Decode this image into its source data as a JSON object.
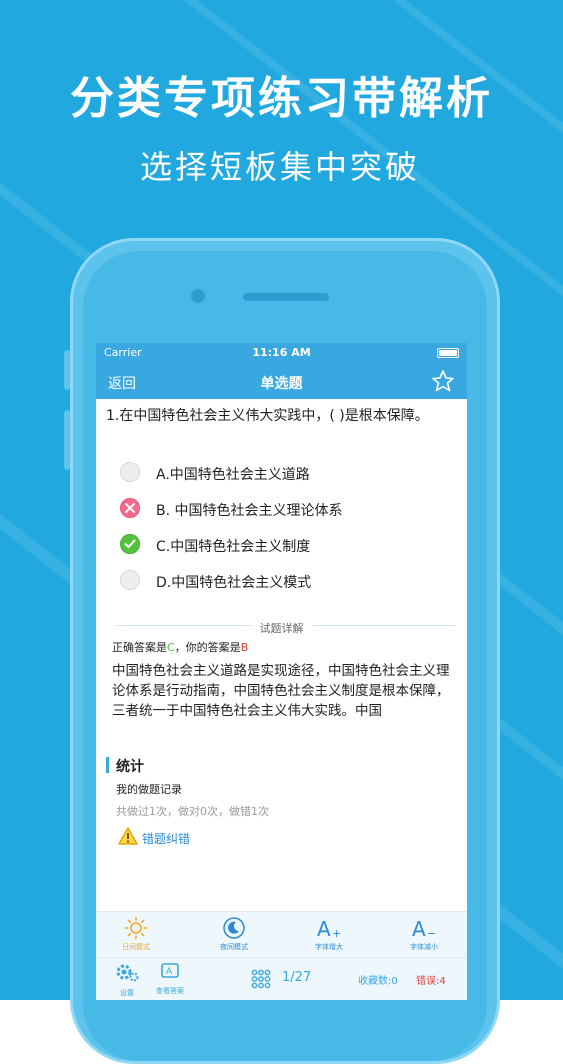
{
  "headline": {
    "title": "分类专项练习带解析",
    "subtitle": "选择短板集中突破"
  },
  "status_bar": {
    "carrier": "Carrier",
    "time": "11:16 AM"
  },
  "nav": {
    "back": "返回",
    "title": "单选题",
    "star_icon": "star-icon"
  },
  "question": {
    "text": "1.在中国特色社会主义伟大实践中，( )是根本保障。",
    "options": [
      {
        "label": "A.中国特色社会主义道路",
        "state": "unselected"
      },
      {
        "label": "B. 中国特色社会主义理论体系",
        "state": "wrong"
      },
      {
        "label": "C.中国特色社会主义制度",
        "state": "correct"
      },
      {
        "label": "D.中国特色社会主义模式",
        "state": "unselected"
      }
    ]
  },
  "analysis": {
    "divider_label": "试题详解",
    "correct_prefix": "正确答案是",
    "correct_answer": "C",
    "separator": "，你的答案是",
    "your_answer": "B",
    "explanation": "中国特色社会主义道路是实现途径，中国特色社会主义理论体系是行动指南，中国特色社会主义制度是根本保障，三者统一于中国特色社会主义伟大实践。中国"
  },
  "stats": {
    "title": "统计",
    "record_label": "我的做题记录",
    "record_detail": "共做过1次，做对0次，做错1次",
    "report_label": "错题纠错"
  },
  "toolbar": {
    "day_mode": "日间模式",
    "night_mode": "夜间模式",
    "font_increase": "字体增大",
    "font_decrease": "字体减小"
  },
  "bottom_bar": {
    "settings": "设置",
    "view_answer": "查看答案",
    "page": "1/27",
    "favorites": "收藏数:0",
    "errors": "错误:4"
  },
  "colors": {
    "background": "#21a9df",
    "nav": "#3aa8e0",
    "correct": "#55c23f",
    "wrong": "#e0403a",
    "orange": "#f5a623"
  }
}
